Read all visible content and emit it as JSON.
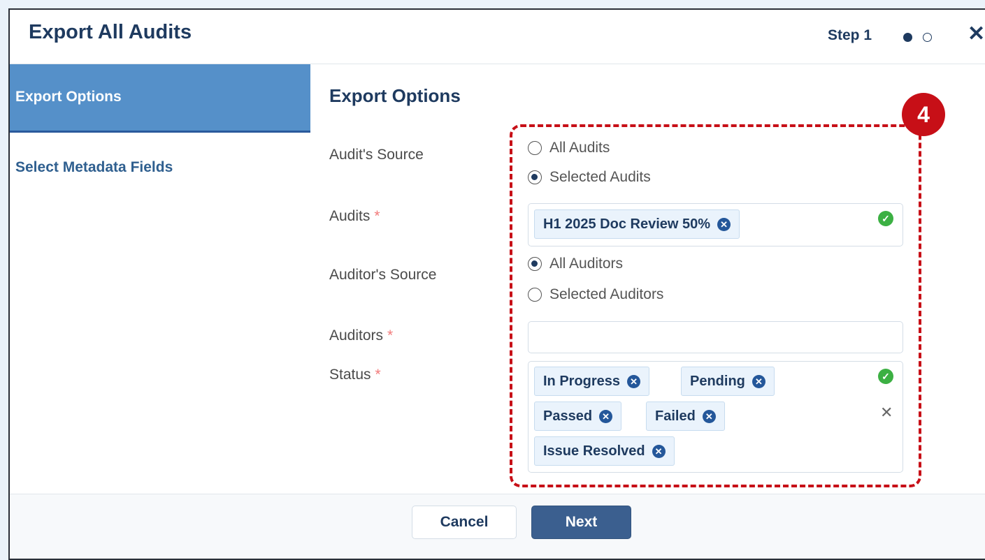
{
  "dialog": {
    "title": "Export All Audits",
    "step_label": "Step 1",
    "current_step": 1,
    "total_steps": 2
  },
  "sidebar": {
    "items": [
      {
        "label": "Export Options",
        "active": true
      },
      {
        "label": "Select Metadata Fields",
        "active": false
      }
    ]
  },
  "main": {
    "section_title": "Export Options",
    "audit_source": {
      "label": "Audit's Source",
      "options": [
        "All Audits",
        "Selected Audits"
      ],
      "selected": "Selected Audits"
    },
    "audits": {
      "label": "Audits",
      "required_mark": "*",
      "tags": [
        "H1 2025 Doc Review 50%"
      ]
    },
    "auditor_source": {
      "label": "Auditor's Source",
      "options": [
        "All Auditors",
        "Selected Auditors"
      ],
      "selected": "All Auditors"
    },
    "auditors": {
      "label": "Auditors",
      "required_mark": "*",
      "value": ""
    },
    "status": {
      "label": "Status",
      "required_mark": "*",
      "tags": [
        "In Progress",
        "Pending",
        "Passed",
        "Failed",
        "Issue Resolved"
      ]
    }
  },
  "footer": {
    "cancel_label": "Cancel",
    "next_label": "Next"
  },
  "annotation": {
    "badge_number": "4",
    "color": "#c70f17"
  },
  "colors": {
    "primary": "#1e3a5f",
    "sidebar_active": "#5590c9",
    "valid": "#3cb043"
  }
}
